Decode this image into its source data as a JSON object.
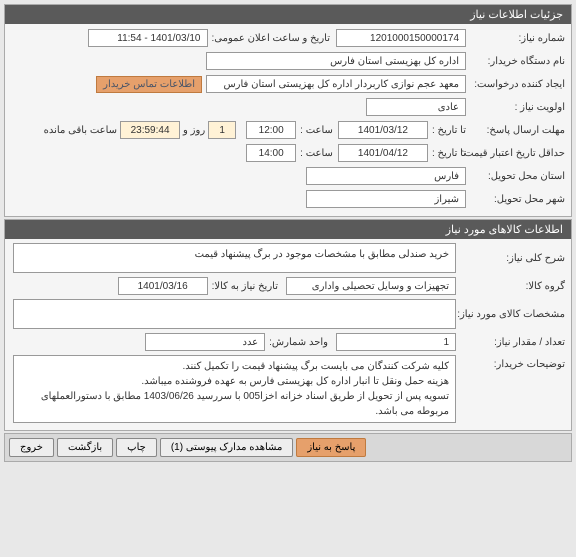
{
  "section1": {
    "title": "جزئیات اطلاعات نیاز",
    "need_number_label": "شماره نیاز:",
    "need_number": "1201000150000174",
    "announce_label": "تاریخ و ساعت اعلان عمومی:",
    "announce_value": "1401/03/10 - 11:54",
    "buyer_label": "نام دستگاه خریدار:",
    "buyer_value": "اداره کل بهزیستی استان فارس",
    "requester_label": "ایجاد کننده درخواست:",
    "requester_value": "معهد عجم نوازی کاربردار اداره کل بهزیستی استان فارس",
    "contact_btn": "اطلاعات تماس خریدار",
    "priority_label": "اولویت نیاز :",
    "priority_value": "عادی",
    "deadline_send_label": "مهلت ارسال پاسخ:",
    "deadline_label_inline": "تا تاریخ :",
    "deadline_date": "1401/03/12",
    "time_label": "ساعت :",
    "deadline_time": "12:00",
    "remain_days": "1",
    "remain_days_label": "روز و",
    "remain_time": "23:59:44",
    "remain_time_label": "ساعت باقی مانده",
    "validity_label": "حداقل تاریخ اعتبار قیمت:",
    "validity_date": "1401/04/12",
    "validity_time": "14:00",
    "province_label": "استان محل تحویل:",
    "province_value": "فارس",
    "city_label": "شهر محل تحویل:",
    "city_value": "شیراز"
  },
  "section2": {
    "title": "اطلاعات کالاهای مورد نیاز",
    "desc_label": "شرح کلی نیاز:",
    "desc_value": "خرید صندلی مطابق با مشخصات موجود در برگ پیشنهاد قیمت",
    "group_label": "گروه کالا:",
    "group_value": "تجهیزات و وسایل تحصیلی واداری",
    "need_date_label": "تاریخ نیاز به کالا:",
    "need_date_value": "1401/03/16",
    "spec_label": "مشخصات کالای مورد نیاز:",
    "spec_value": "",
    "qty_label": "تعداد / مقدار نیاز:",
    "qty_value": "1",
    "unit_label": "واحد شمارش:",
    "unit_value": "عدد",
    "notes_label": "توضیحات خریدار:",
    "notes_value": "کلیه شرکت کنندگان می بایست برگ پیشنهاد قیمت را تکمیل کنند.\nهزینه حمل ونقل تا انبار اداره کل بهزیستی فارس به عهده فروشنده میباشد.\nتسویه پس از تحویل از طریق اسناد خزانه اخزا005  با سررسید 1403/06/26 مطابق با دستورالعملهای مربوطه می باشد."
  },
  "footer": {
    "respond": "پاسخ به نیاز",
    "attachments": "مشاهده مدارک پیوستی (1)",
    "print": "چاپ",
    "back": "بازگشت",
    "exit": "خروج"
  }
}
